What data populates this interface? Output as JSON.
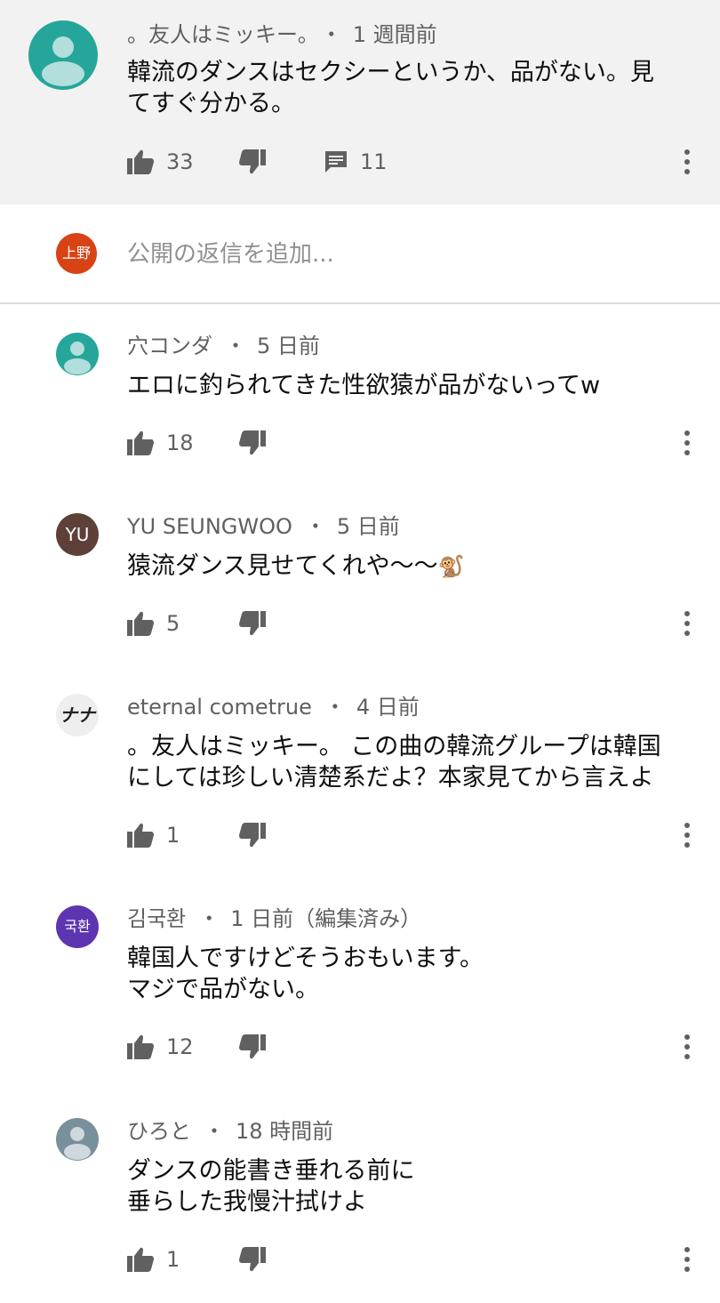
{
  "parent_comment": {
    "author": "。友人はミッキー。",
    "time": "1 週間前",
    "text": "韓流のダンスはセクシーというか、品がない。見\nてすぐ分かる。",
    "likes": "33",
    "replies": "11",
    "avatar_color": "#26a69a"
  },
  "reply_bar": {
    "avatar_label": "上野",
    "avatar_color": "#d84315",
    "placeholder": "公開の返信を追加..."
  },
  "replies": [
    {
      "author": "穴コンダ",
      "time": "5 日前",
      "text": "エロに釣られてきた性欲猿が品がないってw",
      "likes": "18",
      "avatar_color": "#26a69a"
    },
    {
      "author": "YU SEUNGWOO",
      "time": "5 日前",
      "text": "猿流ダンス見せてくれや〜〜",
      "emoji": "🐒",
      "likes": "5",
      "avatar_label": "YU",
      "avatar_color": "#5d4037"
    },
    {
      "author": "eternal cometrue",
      "time": "4 日前",
      "text": "。友人はミッキー。 この曲の韓流グループは韓国\nにしては珍しい清楚系だよ？本家見てから言えよ",
      "likes": "1",
      "avatar_label": "ナナ",
      "avatar_color": "#eeeeee"
    },
    {
      "author": "김국환",
      "time": "1 日前（編集済み）",
      "text": "韓国人ですけどそうおもいます。\nマジで品がない。",
      "likes": "12",
      "avatar_label": "국환",
      "avatar_color": "#5e35b1"
    },
    {
      "author": "ひろと",
      "time": "18 時間前",
      "text": "ダンスの能書き垂れる前に\n垂らした我慢汁拭けよ",
      "likes": "1",
      "avatar_color": "#78909c"
    }
  ],
  "separator": "・"
}
